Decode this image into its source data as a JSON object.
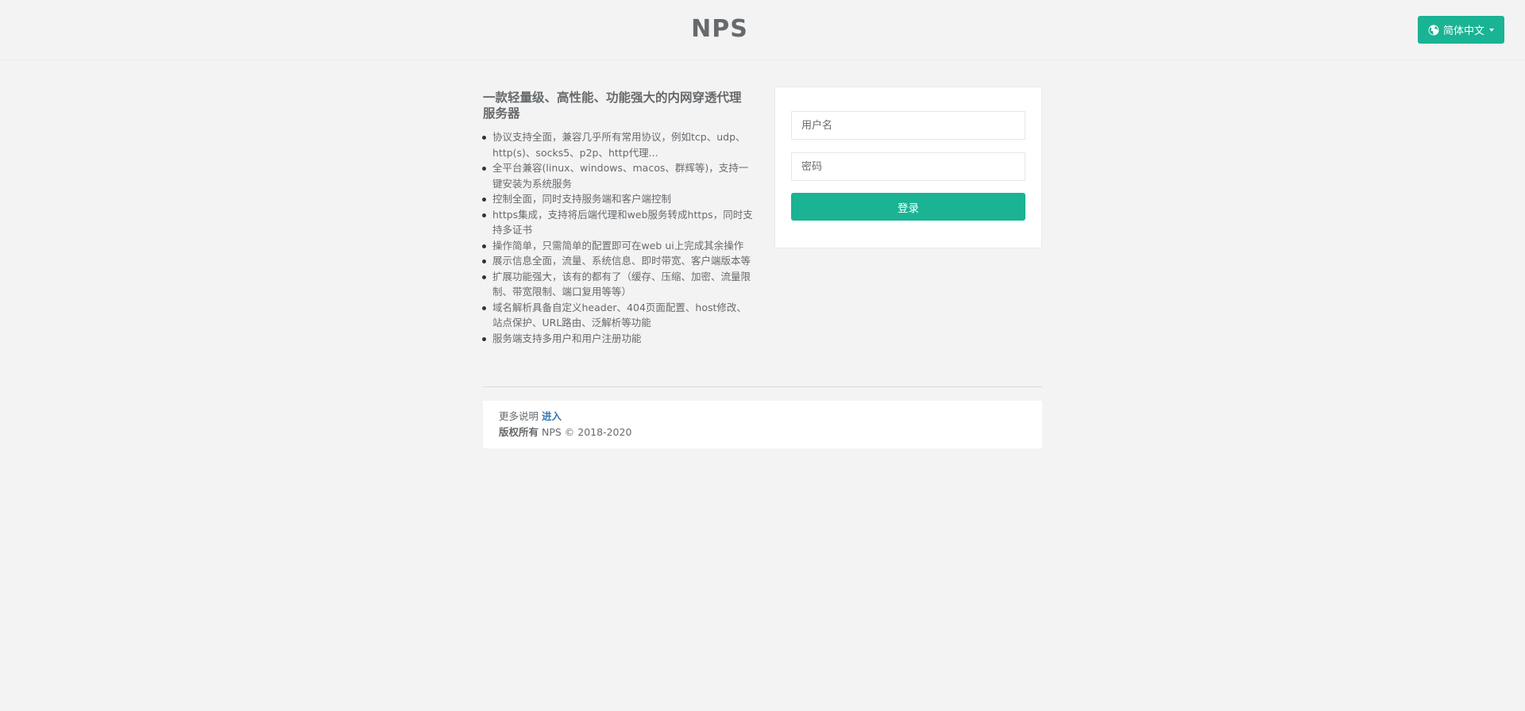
{
  "header": {
    "brand": "NPS",
    "language_button": "简体中文",
    "icons": {
      "language": "globe-icon",
      "dropdown": "caret-down-icon"
    },
    "accent_color": "#1ab394"
  },
  "intro": {
    "title": "一款轻量级、高性能、功能强大的内网穿透代理服务器",
    "features": [
      "协议支持全面，兼容几乎所有常用协议，例如tcp、udp、http(s)、socks5、p2p、http代理...",
      "全平台兼容(linux、windows、macos、群辉等)，支持一键安装为系统服务",
      "控制全面，同时支持服务端和客户端控制",
      "https集成，支持将后端代理和web服务转成https，同时支持多证书",
      "操作简单，只需简单的配置即可在web ui上完成其余操作",
      "展示信息全面，流量、系统信息、即时带宽、客户端版本等",
      "扩展功能强大，该有的都有了（缓存、压缩、加密、流量限制、带宽限制、端口复用等等）",
      "域名解析具备自定义header、404页面配置、host修改、站点保护、URL路由、泛解析等功能",
      "服务端支持多用户和用户注册功能"
    ]
  },
  "login": {
    "username_placeholder": "用户名",
    "username_value": "",
    "password_placeholder": "密码",
    "password_value": "",
    "submit_label": "登录"
  },
  "footer": {
    "more_label": "更多说明",
    "more_link": "进入",
    "copyright_label": "版权所有",
    "copyright_text": "NPS © 2018-2020"
  }
}
